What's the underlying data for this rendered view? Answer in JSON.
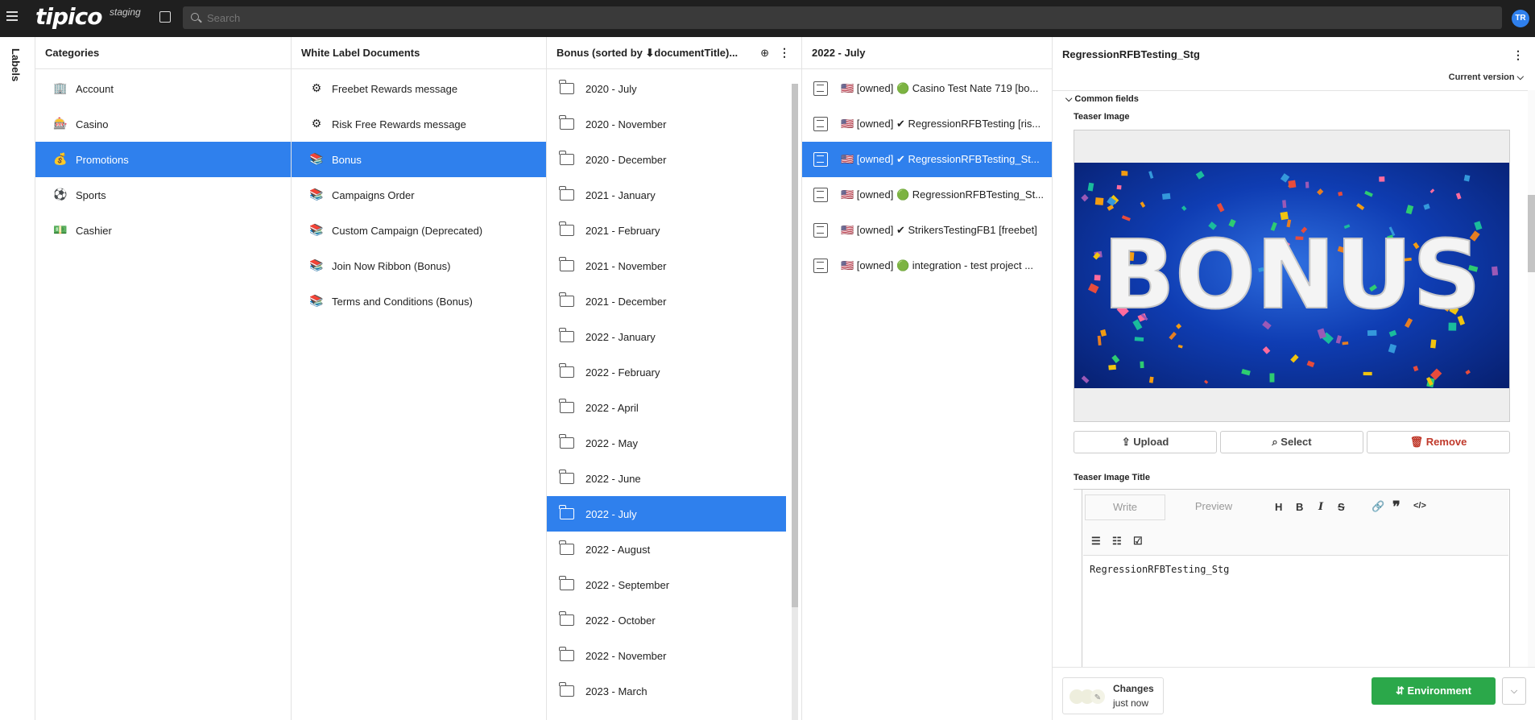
{
  "header": {
    "logo": "tipico",
    "environment": "staging",
    "search_placeholder": "Search",
    "avatar": "TR"
  },
  "sidebar_label": "Labels",
  "categories": {
    "title": "Categories",
    "items": [
      {
        "icon": "🏢",
        "label": "Account"
      },
      {
        "icon": "🎰",
        "label": "Casino"
      },
      {
        "icon": "💰",
        "label": "Promotions"
      },
      {
        "icon": "⚽",
        "label": "Sports"
      },
      {
        "icon": "💵",
        "label": "Cashier"
      }
    ]
  },
  "documents": {
    "title": "White Label Documents",
    "items": [
      {
        "icon": "⚙",
        "label": "Freebet Rewards message"
      },
      {
        "icon": "⚙",
        "label": "Risk Free Rewards message"
      },
      {
        "icon": "📚",
        "label": "Bonus"
      },
      {
        "icon": "📚",
        "label": "Campaigns Order"
      },
      {
        "icon": "📚",
        "label": "Custom Campaign (Deprecated)"
      },
      {
        "icon": "📚",
        "label": "Join Now Ribbon (Bonus)"
      },
      {
        "icon": "📚",
        "label": "Terms and Conditions (Bonus)"
      }
    ]
  },
  "bonus_folders": {
    "title": "Bonus (sorted by ⬇documentTitle)...",
    "items": [
      "2020 - July",
      "2020 - November",
      "2020 - December",
      "2021 - January",
      "2021 - February",
      "2021 - November",
      "2021 - December",
      "2022 - January",
      "2022 - February",
      "2022 - April",
      "2022 - May",
      "2022 - June",
      "2022 - July",
      "2022 - August",
      "2022 - September",
      "2022 - October",
      "2022 - November",
      "2023 - March"
    ]
  },
  "july_docs": {
    "title": "2022 - July",
    "items": [
      "🇺🇸 [owned] 🟢 Casino Test Nate 719 [bo...",
      "🇺🇸 [owned] ✔ RegressionRFBTesting [ris...",
      "🇺🇸 [owned] ✔ RegressionRFBTesting_St...",
      "🇺🇸 [owned] 🟢 RegressionRFBTesting_St...",
      "🇺🇸 [owned] ✔ StrikersTestingFB1 [freebet]",
      "🇺🇸 [owned] 🟢 integration - test project ..."
    ]
  },
  "editor": {
    "title": "RegressionRFBTesting_Stg",
    "version": "Current version",
    "section": "Common fields",
    "teaser_image_label": "Teaser Image",
    "image_text": "BONUS",
    "buttons": {
      "upload": "Upload",
      "select": "Select",
      "remove": "Remove"
    },
    "teaser_title_label": "Teaser Image Title",
    "tabs": {
      "write": "Write",
      "preview": "Preview"
    },
    "content": "RegressionRFBTesting_Stg"
  },
  "footer": {
    "changes": "Changes",
    "changes_time": "just now",
    "environment_button": "Environment"
  },
  "colors": {
    "accent": "#2f80ed",
    "environment": "#2ba84a",
    "topbar": "#1f1f1f"
  }
}
